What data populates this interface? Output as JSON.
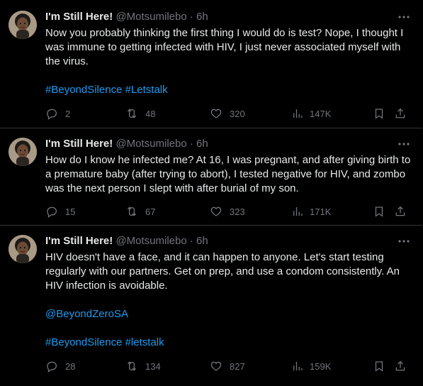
{
  "tweets": [
    {
      "author_name": "I'm Still Here!",
      "author_handle": "@Motsumilebo",
      "separator": "·",
      "time": "6h",
      "paragraphs": [
        "Now you probably thinking the first thing I would do is test? Nope, I thought I was immune to getting infected with HIV, I just never associated myself with the virus."
      ],
      "hashtag_line": [
        "#BeyondSilence",
        "#Letstalk"
      ],
      "replies": "2",
      "reposts": "48",
      "likes": "320",
      "views": "147K"
    },
    {
      "author_name": "I'm Still Here!",
      "author_handle": "@Motsumilebo",
      "separator": "·",
      "time": "6h",
      "paragraphs": [
        "How do I know he infected me? At 16, I was pregnant, and after giving birth to a premature baby (after trying to abort), I tested negative for HIV, and zombo was the next person I slept with after burial of my son."
      ],
      "replies": "15",
      "reposts": "67",
      "likes": "323",
      "views": "171K"
    },
    {
      "author_name": "I'm Still Here!",
      "author_handle": "@Motsumilebo",
      "separator": "·",
      "time": "6h",
      "paragraphs": [
        "HIV doesn't have a face, and it can happen to anyone. Let's start testing regularly with our partners. Get on prep, and use a condom consistently. An HIV infection is avoidable."
      ],
      "mention": "@BeyondZeroSA",
      "hashtag_line": [
        "#BeyondSilence",
        "#letstalk"
      ],
      "replies": "28",
      "reposts": "134",
      "likes": "827",
      "views": "159K"
    }
  ],
  "icons": {
    "reply": "reply-icon",
    "repost": "repost-icon",
    "like": "like-icon",
    "views": "views-icon",
    "bookmark": "bookmark-icon",
    "share": "share-icon",
    "more": "more-icon"
  },
  "colors": {
    "background": "#000000",
    "text": "#e7e9ea",
    "muted": "#71767b",
    "link": "#1d9bf0",
    "divider": "#2f3336"
  }
}
